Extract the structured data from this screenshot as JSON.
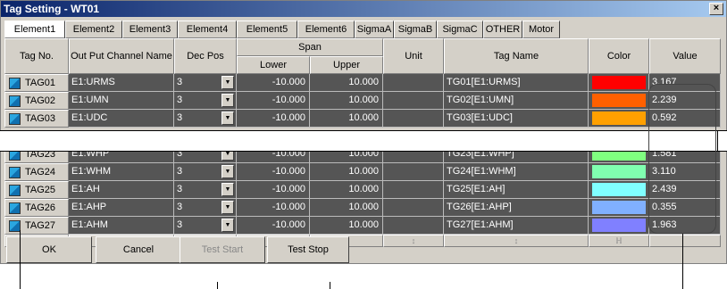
{
  "window": {
    "title": "Tag Setting - WT01",
    "close_label": "×"
  },
  "tabs": [
    "Element1",
    "Element2",
    "Element3",
    "Element4",
    "Element5",
    "Element6",
    "SigmaA",
    "SigmaB",
    "SigmaC",
    "OTHER",
    "Motor"
  ],
  "active_tab": "Element1",
  "headers": {
    "tag_no": "Tag No.",
    "output_channel": "Out Put Channel Name",
    "dec_pos": "Dec Pos",
    "span": "Span",
    "lower": "Lower",
    "upper": "Upper",
    "unit": "Unit",
    "tag_name": "Tag Name",
    "color": "Color",
    "value": "Value"
  },
  "rows": [
    {
      "tag": "TAG01",
      "channel": "E1:URMS",
      "dec": "3",
      "lower": "-10.000",
      "upper": "10.000",
      "unit": "",
      "tagname": "TG01[E1:URMS]",
      "color": "#ff0000",
      "value": "3.167"
    },
    {
      "tag": "TAG02",
      "channel": "E1:UMN",
      "dec": "3",
      "lower": "-10.000",
      "upper": "10.000",
      "unit": "",
      "tagname": "TG02[E1:UMN]",
      "color": "#ff6000",
      "value": "2.239"
    },
    {
      "tag": "TAG03",
      "channel": "E1:UDC",
      "dec": "3",
      "lower": "-10.000",
      "upper": "10.000",
      "unit": "",
      "tagname": "TG03[E1:UDC]",
      "color": "#ffa000",
      "value": "0.592"
    },
    {
      "tag": "TAG23",
      "channel": "E1:WHP",
      "dec": "3",
      "lower": "-10.000",
      "upper": "10.000",
      "unit": "",
      "tagname": "TG23[E1:WHP]",
      "color": "#80ff80",
      "value": "1.581"
    },
    {
      "tag": "TAG24",
      "channel": "E1:WHM",
      "dec": "3",
      "lower": "-10.000",
      "upper": "10.000",
      "unit": "",
      "tagname": "TG24[E1:WHM]",
      "color": "#80ffb0",
      "value": "3.110"
    },
    {
      "tag": "TAG25",
      "channel": "E1:AH",
      "dec": "3",
      "lower": "-10.000",
      "upper": "10.000",
      "unit": "",
      "tagname": "TG25[E1:AH]",
      "color": "#80ffff",
      "value": "2.439"
    },
    {
      "tag": "TAG26",
      "channel": "E1:AHP",
      "dec": "3",
      "lower": "-10.000",
      "upper": "10.000",
      "unit": "",
      "tagname": "TG26[E1:AHP]",
      "color": "#80b0ff",
      "value": "0.355"
    },
    {
      "tag": "TAG27",
      "channel": "E1:AHM",
      "dec": "3",
      "lower": "-10.000",
      "upper": "10.000",
      "unit": "",
      "tagname": "TG27[E1:AHM]",
      "color": "#8080ff",
      "value": "1.963"
    }
  ],
  "scroll_marks": {
    "first": "⊖",
    "resize": "↕",
    "last": "ℍ"
  },
  "buttons": {
    "ok": "OK",
    "cancel": "Cancel",
    "test_start": "Test Start",
    "test_stop": "Test Stop"
  }
}
